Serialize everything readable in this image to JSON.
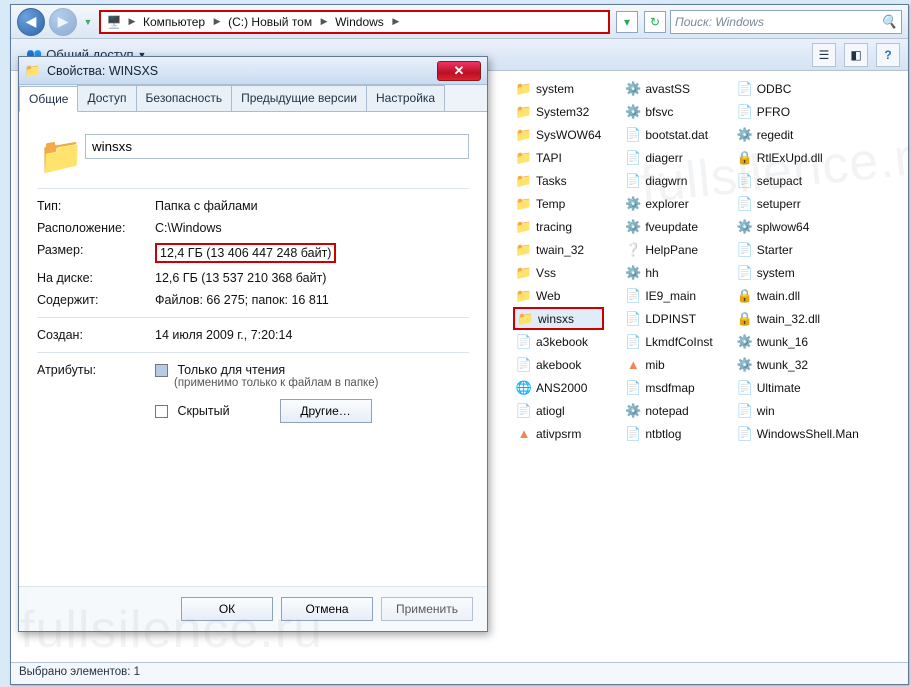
{
  "address": {
    "crumbs": [
      "Компьютер",
      "(C:) Новый том",
      "Windows"
    ],
    "refresh_tip": "Обновить"
  },
  "search": {
    "placeholder": "Поиск: Windows"
  },
  "toolbar": {
    "share": "Общий доступ",
    "question_tip": "Справка"
  },
  "columns": [
    [
      {
        "icon": "folder",
        "name": "system"
      },
      {
        "icon": "folder",
        "name": "System32"
      },
      {
        "icon": "folder",
        "name": "SysWOW64"
      },
      {
        "icon": "folder",
        "name": "TAPI"
      },
      {
        "icon": "folder",
        "name": "Tasks"
      },
      {
        "icon": "folder",
        "name": "Temp"
      },
      {
        "icon": "folder",
        "name": "tracing"
      },
      {
        "icon": "folder",
        "name": "twain_32"
      },
      {
        "icon": "folder",
        "name": "Vss"
      },
      {
        "icon": "folder",
        "name": "Web"
      },
      {
        "icon": "folder",
        "name": "winsxs",
        "selected": true
      },
      {
        "icon": "file",
        "name": "a3kebook"
      },
      {
        "icon": "file",
        "name": "akebook"
      },
      {
        "icon": "globe",
        "name": "ANS2000"
      },
      {
        "icon": "file",
        "name": "atiogl"
      },
      {
        "icon": "vlc",
        "name": "ativpsrm"
      }
    ],
    [
      {
        "icon": "exe",
        "name": "avastSS"
      },
      {
        "icon": "exe",
        "name": "bfsvc"
      },
      {
        "icon": "file",
        "name": "bootstat.dat"
      },
      {
        "icon": "file",
        "name": "diagerr"
      },
      {
        "icon": "file",
        "name": "diagwrn"
      },
      {
        "icon": "exe",
        "name": "explorer"
      },
      {
        "icon": "exe",
        "name": "fveupdate"
      },
      {
        "icon": "help",
        "name": "HelpPane"
      },
      {
        "icon": "exe",
        "name": "hh"
      },
      {
        "icon": "file",
        "name": "IE9_main"
      },
      {
        "icon": "file",
        "name": "LDPINST"
      },
      {
        "icon": "file",
        "name": "LkmdfCoInst"
      },
      {
        "icon": "vlc",
        "name": "mib"
      },
      {
        "icon": "file",
        "name": "msdfmap"
      },
      {
        "icon": "exe",
        "name": "notepad"
      },
      {
        "icon": "file",
        "name": "ntbtlog"
      }
    ],
    [
      {
        "icon": "file",
        "name": "ODBC"
      },
      {
        "icon": "file",
        "name": "PFRO"
      },
      {
        "icon": "exe",
        "name": "regedit"
      },
      {
        "icon": "dll",
        "name": "RtlExUpd.dll"
      },
      {
        "icon": "file",
        "name": "setupact"
      },
      {
        "icon": "file",
        "name": "setuperr"
      },
      {
        "icon": "exe",
        "name": "splwow64"
      },
      {
        "icon": "file",
        "name": "Starter"
      },
      {
        "icon": "file",
        "name": "system"
      },
      {
        "icon": "dll",
        "name": "twain.dll"
      },
      {
        "icon": "dll",
        "name": "twain_32.dll"
      },
      {
        "icon": "exe",
        "name": "twunk_16"
      },
      {
        "icon": "exe",
        "name": "twunk_32"
      },
      {
        "icon": "file",
        "name": "Ultimate"
      },
      {
        "icon": "file",
        "name": "win"
      },
      {
        "icon": "file",
        "name": "WindowsShell.Man"
      }
    ]
  ],
  "status": {
    "text": "Выбрано элементов: 1"
  },
  "props": {
    "title": "Свойства: WINSXS",
    "tabs": [
      "Общие",
      "Доступ",
      "Безопасность",
      "Предыдущие версии",
      "Настройка"
    ],
    "name": "winsxs",
    "labels": {
      "type": "Тип:",
      "location": "Расположение:",
      "size": "Размер:",
      "ondisk": "На диске:",
      "contains": "Содержит:",
      "created": "Создан:",
      "attributes": "Атрибуты:"
    },
    "values": {
      "type": "Папка с файлами",
      "location": "C:\\Windows",
      "size": "12,4 ГБ (13 406 447 248 байт)",
      "ondisk": "12,6 ГБ (13 537 210 368 байт)",
      "contains": "Файлов: 66 275; папок: 16 811",
      "created": "14 июля 2009 г., 7:20:14"
    },
    "readonly_label": "Только для чтения",
    "readonly_hint": "(применимо только к файлам в папке)",
    "hidden_label": "Скрытый",
    "other_btn": "Другие…",
    "buttons": {
      "ok": "ОК",
      "cancel": "Отмена",
      "apply": "Применить"
    }
  },
  "watermark": "fullsilence.ru"
}
